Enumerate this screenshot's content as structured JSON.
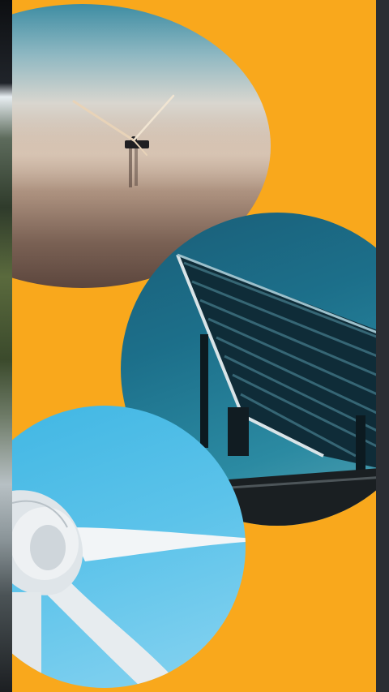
{
  "panel": {
    "background_color": "#f9a81c",
    "photos": [
      {
        "name": "offshore-wind-turbine-photo",
        "icon": "wind-turbine"
      },
      {
        "name": "solar-panel-array-photo",
        "icon": "solar-panel"
      },
      {
        "name": "wind-turbine-closeup-photo",
        "icon": "wind-turbine"
      }
    ]
  },
  "colors": {
    "panel_orange": "#f9a81c",
    "frame_dark": "#24262b",
    "sky_blue": "#3fb6e3",
    "solar_teal": "#1c6f8a"
  }
}
